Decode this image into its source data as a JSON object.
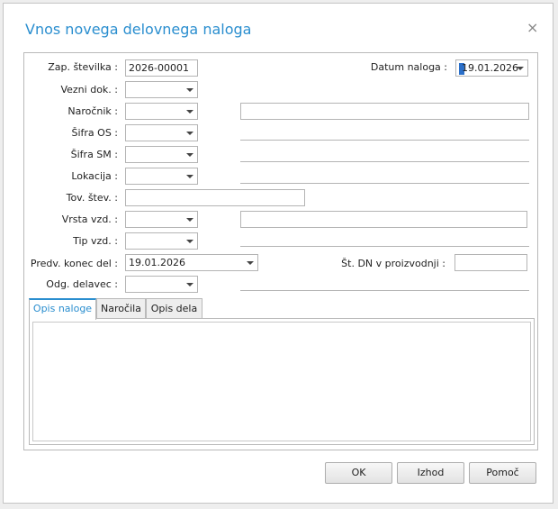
{
  "dialog": {
    "title": "Vnos novega delovnega naloga",
    "close_icon": "×"
  },
  "form": {
    "zap_stevilka": {
      "label": "Zap. številka :",
      "value": "2026-00001"
    },
    "datum_naloga": {
      "label": "Datum naloga :",
      "value": "19.01.2026"
    },
    "vezni_dok": {
      "label": "Vezni dok. :",
      "value": ""
    },
    "narocnik": {
      "label": "Naročnik :",
      "value": "",
      "detail": ""
    },
    "sifra_os": {
      "label": "Šifra OS :",
      "value": ""
    },
    "sifra_sm": {
      "label": "Šifra SM :",
      "value": ""
    },
    "lokacija": {
      "label": "Lokacija :",
      "value": ""
    },
    "tov_stev": {
      "label": "Tov. štev. :",
      "value": ""
    },
    "vrsta_vzd": {
      "label": "Vrsta vzd. :",
      "value": "",
      "detail": ""
    },
    "tip_vzd": {
      "label": "Tip vzd. :",
      "value": ""
    },
    "predv_konec_del": {
      "label": "Predv. konec del :",
      "value": "19.01.2026"
    },
    "st_dn_v_proizvodnji": {
      "label": "Št. DN v proizvodnji :",
      "value": ""
    },
    "odg_delavec": {
      "label": "Odg. delavec :",
      "value": ""
    }
  },
  "tabs": [
    {
      "label": "Opis naloge",
      "active": true
    },
    {
      "label": "Naročila",
      "active": false
    },
    {
      "label": "Opis dela",
      "active": false
    }
  ],
  "buttons": {
    "ok": "OK",
    "izhod": "Izhod",
    "pomoc": "Pomoč"
  },
  "colors": {
    "accent": "#2a8ecf"
  }
}
